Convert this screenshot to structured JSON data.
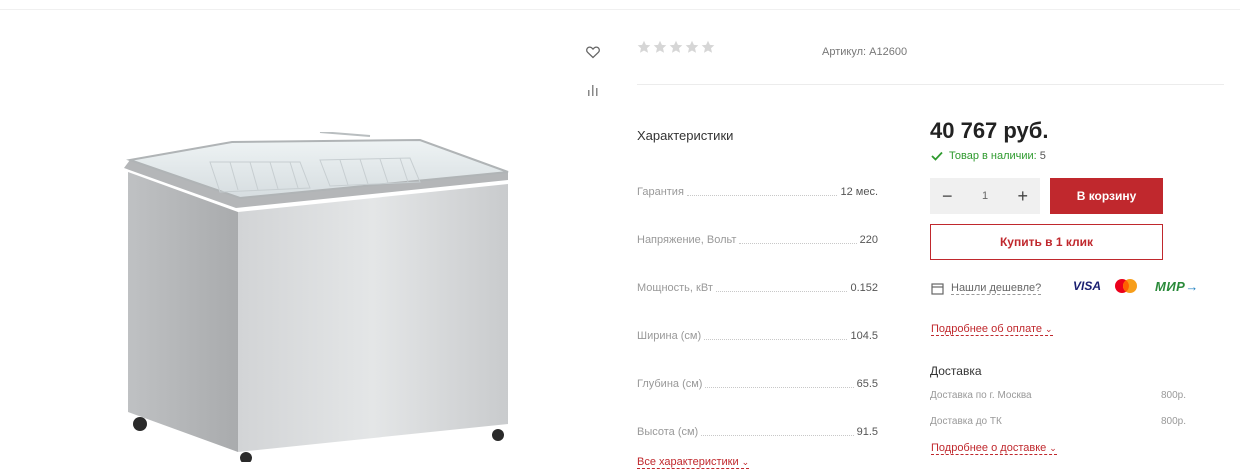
{
  "product": {
    "sku_label": "Артикул:",
    "sku_value": "A12600",
    "rating_stars": 5,
    "rating_value": 0
  },
  "characteristics": {
    "title": "Характеристики",
    "items": [
      {
        "name": "Гарантия",
        "value": "12 мес."
      },
      {
        "name": "Напряжение, Вольт",
        "value": "220"
      },
      {
        "name": "Мощность, кВт",
        "value": "0.152"
      },
      {
        "name": "Ширина (см)",
        "value": "104.5"
      },
      {
        "name": "Глубина (см)",
        "value": "65.5"
      },
      {
        "name": "Высота (см)",
        "value": "91.5"
      }
    ],
    "all_link": "Все характеристики"
  },
  "buy": {
    "price": "40 767 руб.",
    "stock_label": "Товар в наличии:",
    "stock_count": "5",
    "quantity": "1",
    "minus": "−",
    "plus": "+",
    "cart_button": "В корзину",
    "one_click_button": "Купить в 1 клик",
    "cheaper_link": "Нашли дешевле?",
    "payment_more": "Подробнее об оплате",
    "payment_logos": [
      "VISA",
      "MasterCard",
      "МИР"
    ]
  },
  "delivery": {
    "title": "Доставка",
    "rows": [
      {
        "name": "Доставка по г. Москва",
        "price": "800р."
      },
      {
        "name": "Доставка до ТК",
        "price": "800р."
      }
    ],
    "more": "Подробнее о доставке"
  },
  "colors": {
    "accent": "#c0282d",
    "stock_green": "#2e9a2e",
    "star_gray": "#d6d6d6"
  }
}
